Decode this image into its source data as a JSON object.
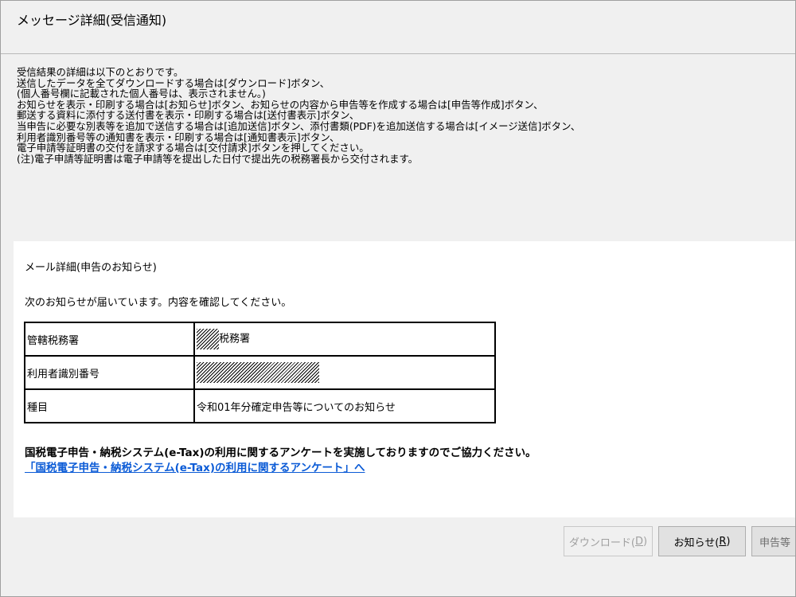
{
  "window": {
    "title": "メッセージ詳細(受信通知)"
  },
  "instructions": [
    "受信結果の詳細は以下のとおりです。",
    "送信したデータを全てダウンロードする場合は[ダウンロード]ボタン、",
    "(個人番号欄に記載された個人番号は、表示されません。)",
    "お知らせを表示・印刷する場合は[お知らせ]ボタン、お知らせの内容から申告等を作成する場合は[申告等作成]ボタン、",
    "郵送する資料に添付する送付書を表示・印刷する場合は[送付書表示]ボタン、",
    "当申告に必要な別表等を追加で送信する場合は[追加送信]ボタン、添付書類(PDF)を追加送信する場合は[イメージ送信]ボタン、",
    "利用者識別番号等の通知書を表示・印刷する場合は[通知書表示]ボタン、",
    "電子申請等証明書の交付を請求する場合は[交付請求]ボタンを押してください。",
    "(注)電子申請等証明書は電子申請等を提出した日付で提出先の税務署長から交付されます。"
  ],
  "mail": {
    "heading": "メール詳細(申告のお知らせ)",
    "message": "次のお知らせが届いています。内容を確認してください。",
    "rows": [
      {
        "label": "管轄税務署",
        "value": "税務署"
      },
      {
        "label": "利用者識別番号",
        "value": ""
      },
      {
        "label": "種目",
        "value": "令和01年分確定申告等についてのお知らせ"
      }
    ],
    "survey_text": "国税電子申告・納税システム(e-Tax)の利用に関するアンケートを実施しておりますのでご協力ください。",
    "survey_link": "「国税電子申告・納税システム(e-Tax)の利用に関するアンケート」へ"
  },
  "buttons": {
    "download": {
      "label": "ダウンロード(",
      "key": "D",
      "suffix": ")",
      "enabled": false
    },
    "notice": {
      "label": "お知らせ(",
      "key": "R",
      "suffix": ")",
      "enabled": true
    },
    "create": {
      "label": "申告等"
    }
  }
}
